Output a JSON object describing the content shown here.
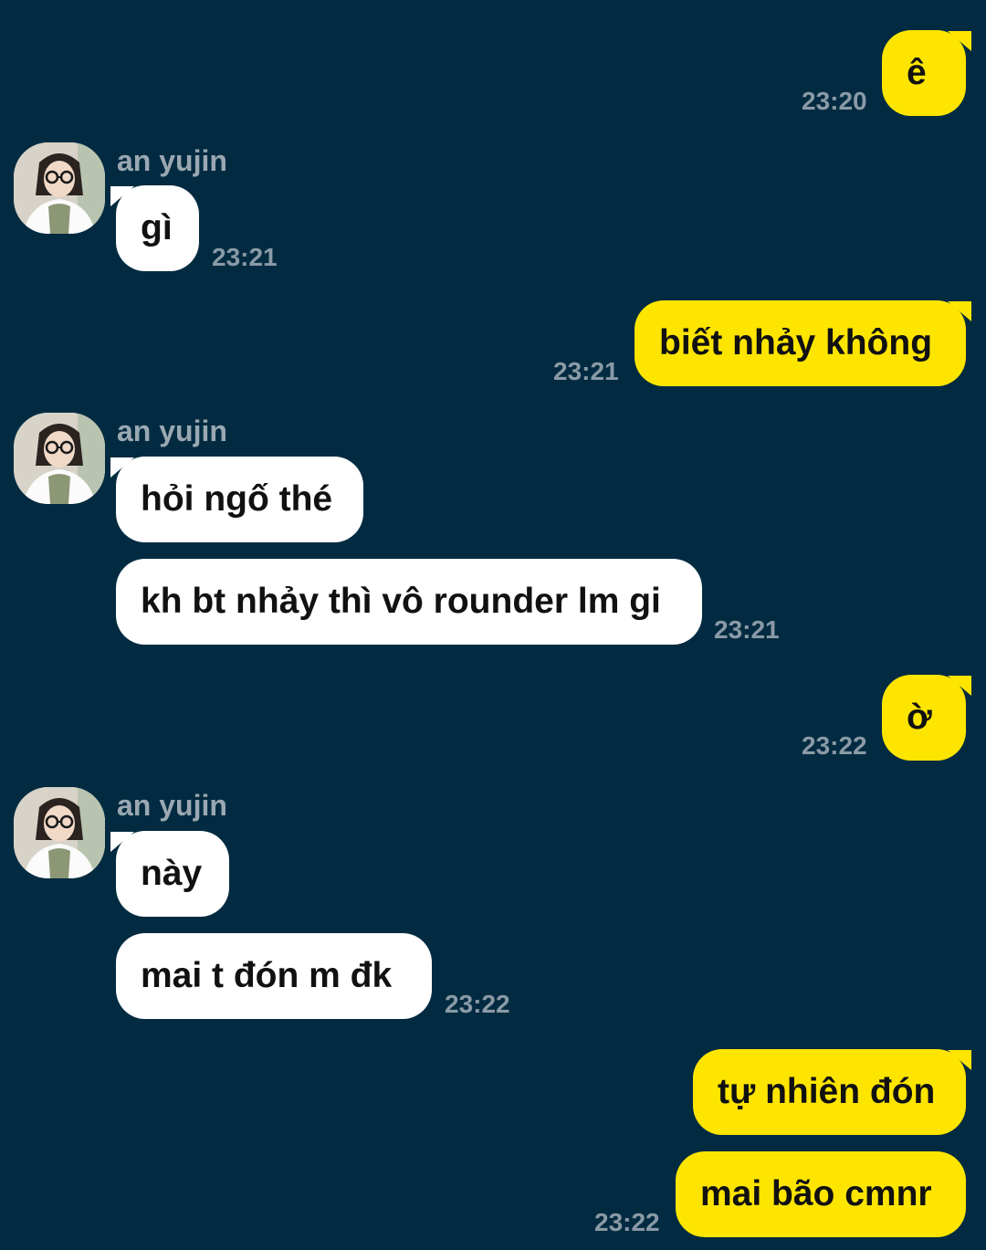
{
  "contact": {
    "name": "an yujin"
  },
  "messages": {
    "m1": {
      "text": "ê",
      "time": "23:20"
    },
    "m2": {
      "text": "gì",
      "time": "23:21"
    },
    "m3": {
      "text": "biết nhảy không",
      "time": "23:21"
    },
    "m4": {
      "text": "hỏi ngố thé"
    },
    "m5": {
      "text": "kh bt nhảy thì vô rounder lm gi",
      "time": "23:21"
    },
    "m6": {
      "text": "ờ",
      "time": "23:22"
    },
    "m7": {
      "text": "này"
    },
    "m8": {
      "text": "mai t đón m đk",
      "time": "23:22"
    },
    "m9": {
      "text": "tự nhiên đón"
    },
    "m10": {
      "text": "mai bão cmnr",
      "time": "23:22"
    }
  },
  "colors": {
    "background": "#022b41",
    "outgoing_bubble": "#fee500",
    "incoming_bubble": "#ffffff",
    "timestamp": "#8a9aa6",
    "sender_name": "#9aa8b2"
  },
  "icons": {
    "avatar": "profile-photo"
  }
}
